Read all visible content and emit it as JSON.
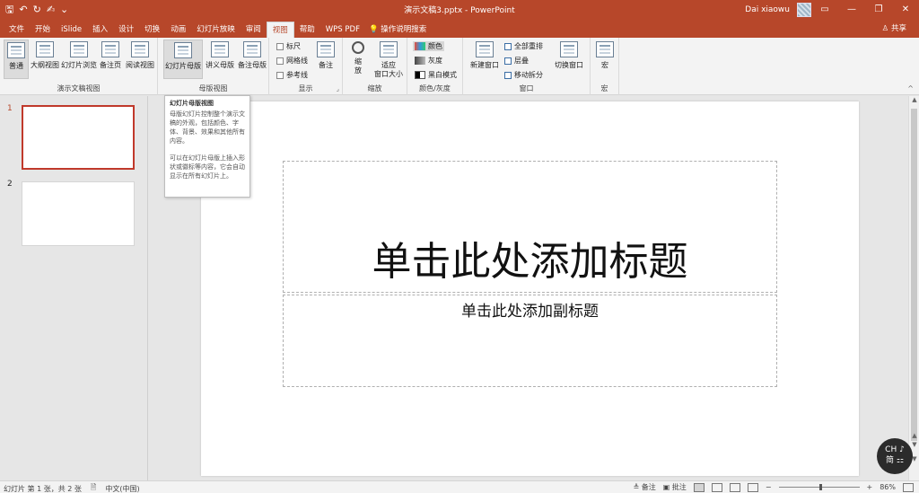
{
  "app": {
    "document_title": "演示文稿3.pptx  -  PowerPoint",
    "user_name": "Dai xiaowu",
    "window_buttons": [
      "▭",
      "—",
      "❐",
      "✕"
    ],
    "share_label": "♙ 共享"
  },
  "qat": [
    "🖫",
    "↶",
    "↻",
    "✍",
    "⌄"
  ],
  "tabs": [
    "文件",
    "开始",
    "iSlide",
    "插入",
    "设计",
    "切换",
    "动画",
    "幻灯片放映",
    "审阅",
    "视图",
    "帮助",
    "WPS PDF"
  ],
  "active_tab": "视图",
  "tell_me": "操作说明搜索",
  "ribbon": {
    "presentation_views": {
      "label": "演示文稿视图",
      "buttons": [
        "普通",
        "大纲视图",
        "幻灯片浏览",
        "备注页",
        "阅读视图"
      ]
    },
    "master_views": {
      "label": "母版视图",
      "buttons": [
        "幻灯片母版",
        "讲义母版",
        "备注母版"
      ]
    },
    "show": {
      "label": "显示",
      "checkboxes": [
        "标尺",
        "网格线",
        "参考线"
      ],
      "notes_button": "备注"
    },
    "zoom": {
      "label": "缩放",
      "zoom_button": "缩\n放",
      "fit_button": "适应\n窗口大小"
    },
    "color": {
      "label": "颜色/灰度",
      "options": [
        "颜色",
        "灰度",
        "黑白模式"
      ]
    },
    "window": {
      "label": "窗口",
      "new_window": "新建窗口",
      "arrange_all": "全部重排",
      "cascade": "层叠",
      "move_split": "移动拆分",
      "switch_windows": "切换窗口"
    },
    "macros": {
      "label": "宏",
      "button": "宏"
    }
  },
  "tooltip": {
    "title": "幻灯片母版视图",
    "para1": "母版幻灯片控制整个演示文稿的外观，包括颜色、字体、背景、效果和其他所有内容。",
    "para2": "可以在幻灯片母版上插入形状或徽标等内容，它会自动显示在所有幻灯片上。"
  },
  "slides": [
    {
      "number": "1"
    },
    {
      "number": "2"
    }
  ],
  "slide": {
    "title_placeholder": "单击此处添加标题",
    "subtitle_placeholder": "单击此处添加副标题"
  },
  "ime": {
    "line1": "CH ♪",
    "line2": "简 ⚏"
  },
  "statusbar": {
    "slide_info": "幻灯片 第 1 张，共 2 张",
    "language": "中文(中国)",
    "notes": "≜ 备注",
    "comments": "▣ 批注",
    "zoom": "86%"
  },
  "colors": {
    "accent": "#b7472a",
    "selection": "#c0392b"
  }
}
